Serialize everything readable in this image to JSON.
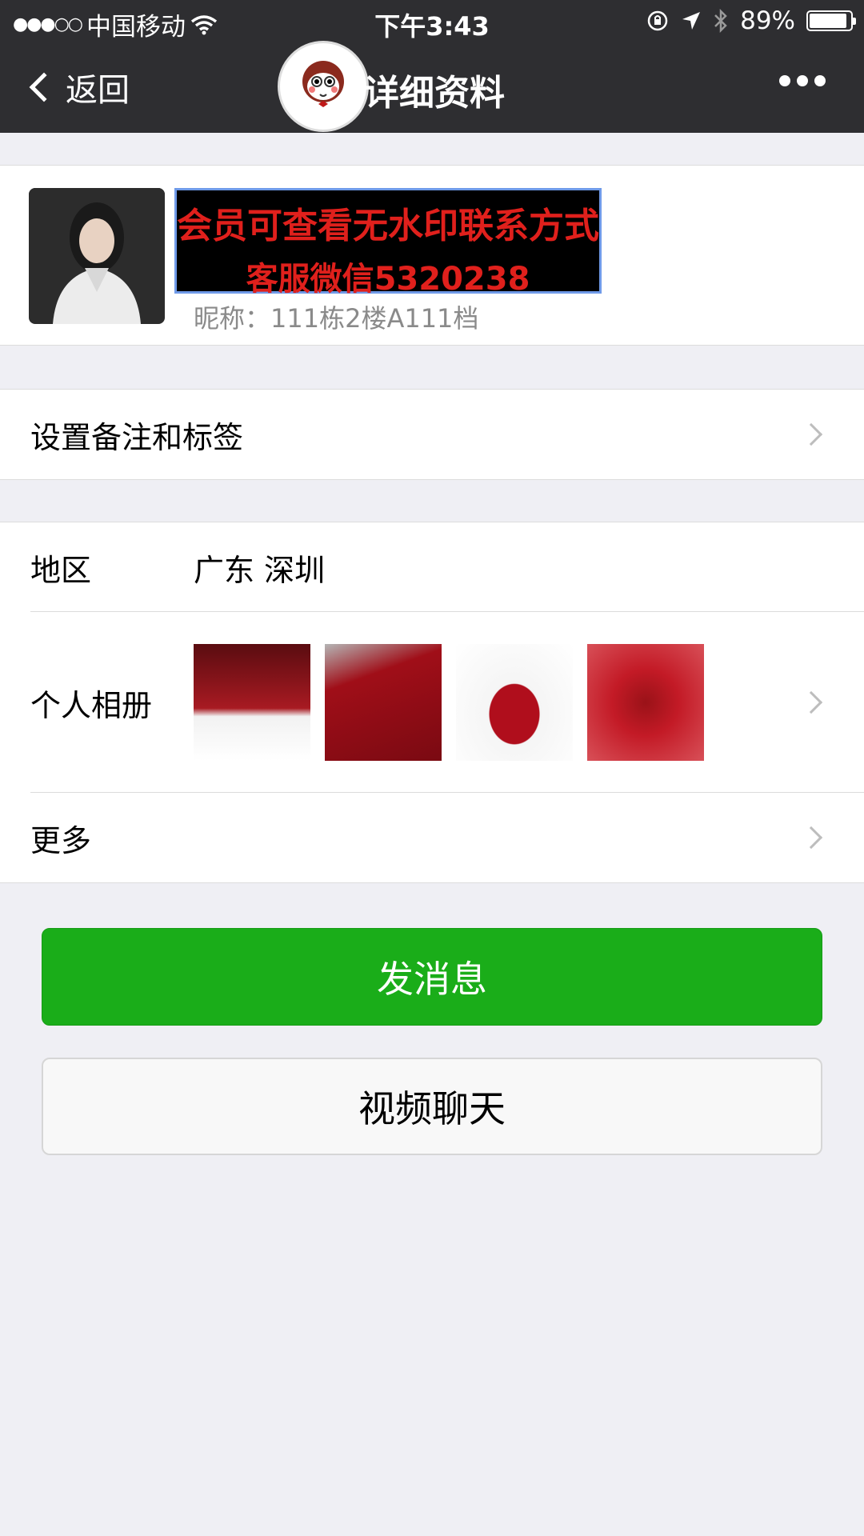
{
  "status_bar": {
    "carrier": "中国移动",
    "signal": "●●●○○",
    "time": "下午3:43",
    "battery": "89%"
  },
  "nav": {
    "back_label": "返回",
    "title": "详细资料"
  },
  "profile": {
    "name_line1": "会员可查看无水印联系方式",
    "name_line2": "客服微信5320238",
    "nickname": "昵称：111栋2楼A111档"
  },
  "rows": {
    "remark_label": "设置备注和标签",
    "region_label": "地区",
    "region_value": "广东 深圳",
    "album_label": "个人相册",
    "more_label": "更多"
  },
  "buttons": {
    "send_message": "发消息",
    "video_chat": "视频聊天"
  },
  "colors": {
    "topbar": "#2e2e31",
    "primary_green": "#1aad19",
    "background": "#efeff4",
    "banner_text": "#e0201c"
  }
}
